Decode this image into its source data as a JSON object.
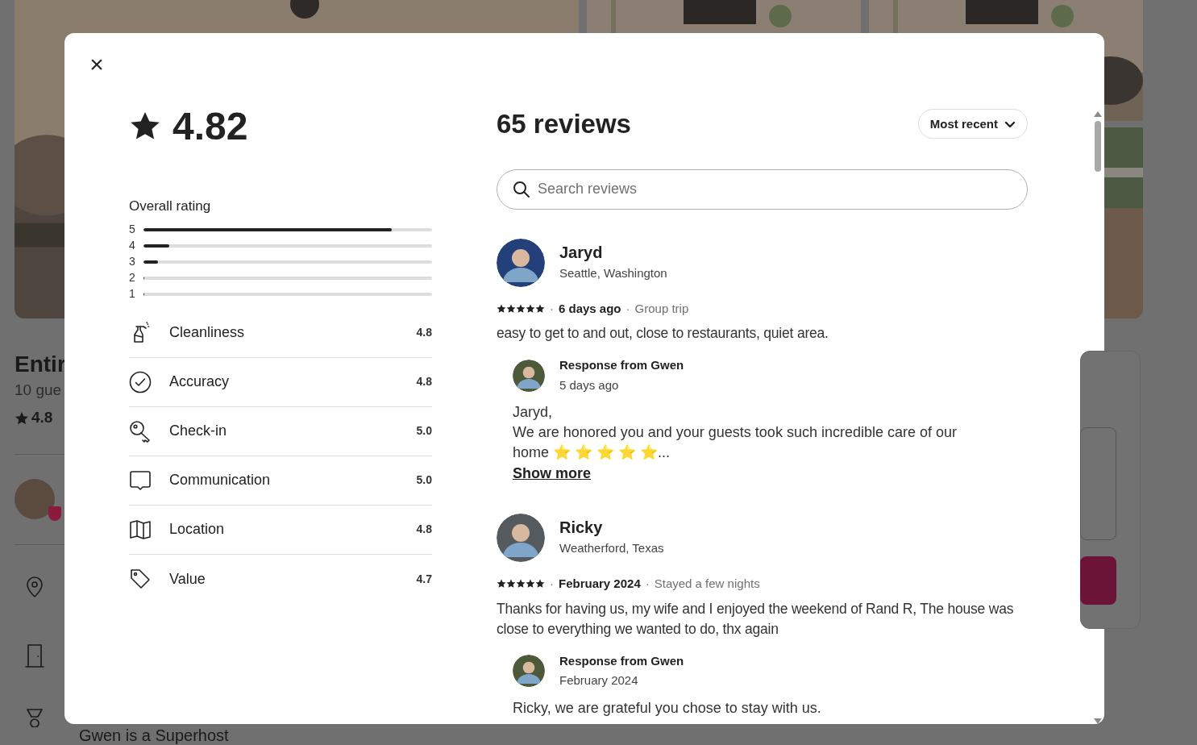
{
  "background": {
    "title": "Entir",
    "guests": "10 gue",
    "rating": "4.8",
    "host_text": "Gwen is a Superhost"
  },
  "modal": {
    "close": "×",
    "summary": {
      "rating": "4.82",
      "overall_label": "Overall rating",
      "distribution": [
        {
          "label": "5",
          "level": 0.86
        },
        {
          "label": "4",
          "level": 0.09
        },
        {
          "label": "3",
          "level": 0.05
        },
        {
          "label": "2",
          "level": 0
        },
        {
          "label": "1",
          "level": 0
        }
      ],
      "categories": [
        {
          "kind": "spray",
          "label": "Cleanliness",
          "score": "4.8"
        },
        {
          "kind": "check",
          "label": "Accuracy",
          "score": "4.8"
        },
        {
          "kind": "key",
          "label": "Check-in",
          "score": "5.0"
        },
        {
          "kind": "chat",
          "label": "Communication",
          "score": "5.0"
        },
        {
          "kind": "map",
          "label": "Location",
          "score": "4.8"
        },
        {
          "kind": "tag",
          "label": "Value",
          "score": "4.7"
        }
      ]
    },
    "reviews_title": "65 reviews",
    "sort": "Most recent",
    "search": {
      "placeholder": "Search reviews"
    },
    "reviews": [
      {
        "name": "Jaryd",
        "location": "Seattle, Washington",
        "stars": 5,
        "separator": "·",
        "date": "6 days ago",
        "trip": "Group trip",
        "text": "easy to get to and out, close to restaurants, quiet area.",
        "response": {
          "title": "Response from Gwen",
          "date": "5 days ago",
          "lines": [
            "Jaryd,",
            "We are honored you and your guests took such incredible care of our home ⭐ ⭐ ⭐ ⭐ ⭐..."
          ],
          "more": "Show more"
        }
      },
      {
        "name": "Ricky",
        "location": "Weatherford, Texas",
        "stars": 5,
        "separator": "·",
        "date": "February 2024",
        "trip": "Stayed a few nights",
        "text": "Thanks for having us, my wife and I enjoyed the weekend of Rand R, The house was close to everything we wanted to do, thx again",
        "response": {
          "title": "Response from Gwen",
          "date": "February 2024",
          "lines": [
            "Ricky, we are grateful you chose to stay with us."
          ]
        }
      }
    ]
  }
}
